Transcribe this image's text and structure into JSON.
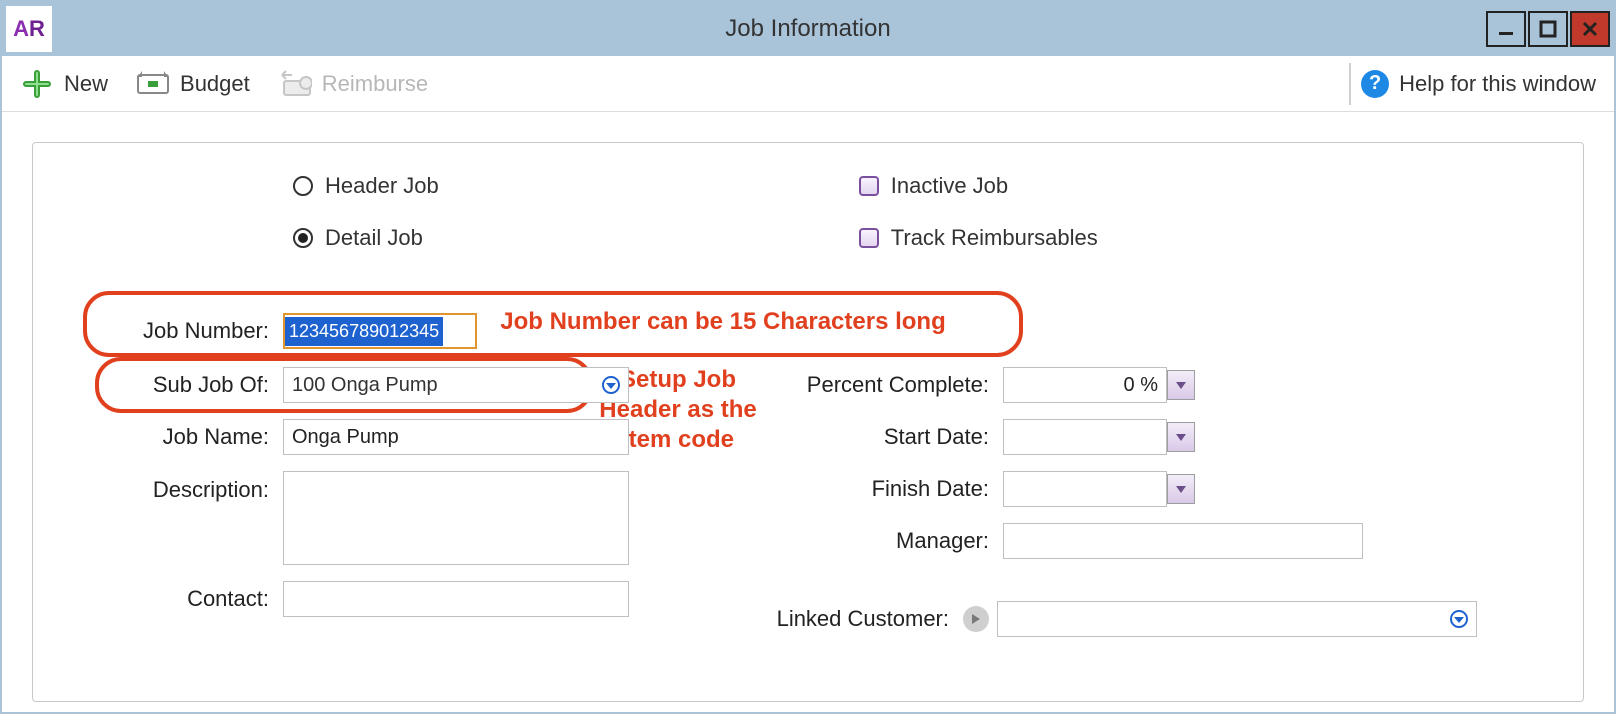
{
  "window": {
    "title": "Job Information",
    "app_icon_text": "AR"
  },
  "toolbar": {
    "new_label": "New",
    "budget_label": "Budget",
    "reimburse_label": "Reimburse",
    "help_label": "Help for this window"
  },
  "options": {
    "header_job_label": "Header Job",
    "detail_job_label": "Detail Job",
    "inactive_label": "Inactive Job",
    "track_reimb_label": "Track Reimbursables",
    "job_type_selected": "detail",
    "inactive_checked": false,
    "track_reimb_checked": false
  },
  "form": {
    "job_number_label": "Job Number:",
    "job_number_value": "123456789012345",
    "sub_job_of_label": "Sub Job Of:",
    "sub_job_of_value": "100 Onga Pump",
    "job_name_label": "Job Name:",
    "job_name_value": "Onga Pump",
    "description_label": "Description:",
    "description_value": "",
    "contact_label": "Contact:",
    "contact_value": "",
    "percent_complete_label": "Percent Complete:",
    "percent_complete_value": "0 %",
    "start_date_label": "Start Date:",
    "start_date_value": "",
    "finish_date_label": "Finish Date:",
    "finish_date_value": "",
    "manager_label": "Manager:",
    "manager_value": "",
    "linked_customer_label": "Linked Customer:",
    "linked_customer_value": ""
  },
  "annotations": {
    "job_number_note": "Job Number can be 15 Characters long",
    "sub_job_note": "Setup  Job Header as the Item code"
  }
}
